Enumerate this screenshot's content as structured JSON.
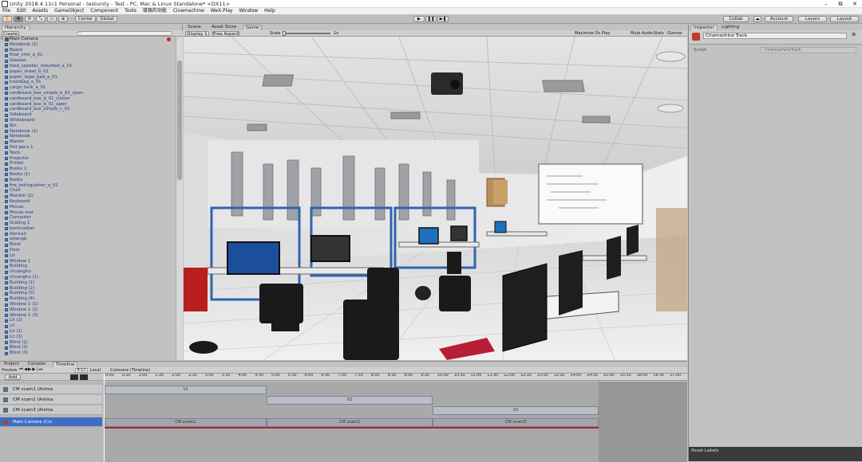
{
  "window": {
    "title": "Unity 2018.4.11c1 Personal - testunity - Test - PC, Mac & Linux Standalone* <DX11>",
    "minimize": "–",
    "maximize": "⧉",
    "close": "✕"
  },
  "menu": [
    "File",
    "Edit",
    "Assets",
    "GameObject",
    "Component",
    "Tools",
    "增强的功能",
    "Cinemachine",
    "WeX.Play",
    "Window",
    "Help"
  ],
  "toolbar": {
    "center_label": "Center",
    "global_label": "Global",
    "collab_label": "Collab",
    "account_label": "Account",
    "layers_label": "Layers",
    "layout_label": "Layout",
    "play_icon": "▶",
    "pause_icon": "❚❚",
    "step_icon": "▶❚",
    "tool_icons": [
      "✋",
      "✥",
      "⟳",
      "⤡",
      "▭",
      "⊕"
    ]
  },
  "hierarchy": {
    "tab": "Hierarchy",
    "create_label": "Create",
    "search_placeholder": "",
    "root": "Main Camera",
    "items": [
      "Notebook (2)",
      "Board",
      "final_vmk_a_01",
      "Glasses",
      "food_speaker_mounted_a_01",
      "paper_sheet_b_01",
      "paper_legal_pad_a_01",
      "trashbag_a_01",
      "cargo_tank_a_01",
      "cardboard_box_simple_b_01_open",
      "cardboard_box_b_01_clutter",
      "cardboard_box_b_01_open",
      "cardboard_box_simple_c_01",
      "Sideboard",
      "Whiteboard",
      "Bin",
      "Notebook (1)",
      "Notebook",
      "Marker",
      "Felt pens 1",
      "Texts",
      "Projector",
      "Printer",
      "Books 2",
      "Books (1)",
      "Books",
      "fire_extinguisher_a_01",
      "Chair",
      "Monitor (2)",
      "Keyboard",
      "Mouse",
      "Mouse mat",
      "Computer",
      "Grating 1",
      "kanhuadian",
      "Almirah",
      "aijiangb",
      "Blind",
      "Door",
      "Lit",
      "Window 1",
      "Building",
      "chuanghu",
      "chuanghu (1)",
      "Building (1)",
      "Building (2)",
      "Building (3)",
      "Building (4)",
      "Window 1 (1)",
      "Window 1 (2)",
      "Window 1 (3)",
      "Lit (2)",
      "Lit",
      "Lit (1)",
      "Lit (3)",
      "Blind (1)",
      "Blind (2)",
      "Blind (3)"
    ]
  },
  "scene_tabs": [
    "Scene",
    "Asset Store",
    "Game"
  ],
  "game_bar": {
    "display": "Display 1",
    "aspect": "Free Aspect",
    "scale_label": "Scale",
    "scale_value": "1x",
    "maximize": "Maximize On Play",
    "mute": "Mute Audio",
    "stats": "Stats",
    "gizmos": "Gizmos"
  },
  "inspector": {
    "tabs": [
      "Inspector",
      "Lighting"
    ],
    "object_name": "Cinemachine Track",
    "script_label": "Script",
    "script_value": "CinemachineTrack",
    "asset_labels": "Asset Labels"
  },
  "bottom_tabs": [
    "Project",
    "Console",
    "Timeline"
  ],
  "timeline": {
    "preview": "Preview",
    "frame": "8:12",
    "local": "Local",
    "add_label": "Add",
    "asset": "Cutscene (Timeline)",
    "ruler": [
      "0:00",
      "0:30",
      "1:00",
      "1:30",
      "2:00",
      "2:30",
      "3:00",
      "3:30",
      "4:00",
      "4:30",
      "5:00",
      "5:30",
      "6:00",
      "6:30",
      "7:00",
      "7:30",
      "8:00",
      "8:30",
      "9:00",
      "9:30",
      "10:00",
      "10:30",
      "11:00",
      "11:30",
      "12:00",
      "12:30",
      "13:00",
      "13:30",
      "14:00",
      "14:30",
      "15:00",
      "15:30",
      "16:00",
      "16:30",
      "17:00"
    ],
    "tracks": [
      "CM vcam1 (Anima",
      "CM vcam2 (Anima",
      "CM vcam3 (Anima",
      "Main Camera (Cin"
    ],
    "clips": [
      "V1",
      "V2",
      "V3",
      "CM vcam1",
      "CM vcam2",
      "CM vcam3"
    ]
  },
  "colors": {
    "accent_play": "#3b7bd9",
    "selected_track": "#3e6fc4",
    "playhead": "#ffffff",
    "track_end_line": "#b0272f"
  }
}
